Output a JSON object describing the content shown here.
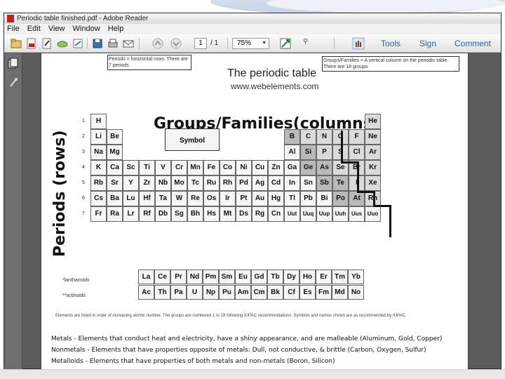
{
  "window": {
    "title": "Periodic table finished.pdf - Adobe Reader"
  },
  "menu": [
    "File",
    "Edit",
    "View",
    "Window",
    "Help"
  ],
  "toolbar": {
    "page_current": "1",
    "page_total": "/ 1",
    "zoom": "75%",
    "tools_label": "Tools",
    "sign_label": "Sign",
    "comment_label": "Comment"
  },
  "document": {
    "title": "The periodic table",
    "url": "www.webelements.com",
    "handwriting": {
      "groups": "Groups/Families(columns)",
      "periods": "Periods (rows)",
      "periods_note": "Periods = horizontal rows. There are 7 periods",
      "groups_note": "Groups/Families = A vertical column on the periodic table. There are 18 groups",
      "metals": "Metals - Elements that conduct heat and electricity, have a shiny appearance, and are malleable (Aluminum, Gold, Copper)",
      "metalloids": "Metalloids - Elements that have properties of both metals and non-metals (Boron, Silicon)",
      "nonmetals": "Nonmetals - Elements that have properties opposite of metals: Dull, not conductive, & brittle (Carbon, Oxygen, Sulfur)"
    },
    "key_symbol": "Symbol",
    "lanthanoids_label": "*lanthanoids",
    "actinoids_label": "**actinoids",
    "periods_numbers": [
      "1",
      "2",
      "3",
      "4",
      "5",
      "6",
      "7"
    ],
    "main_table": [
      [
        "H",
        "",
        "",
        "",
        "",
        "",
        "",
        "",
        "",
        "",
        "",
        "",
        "",
        "",
        "",
        "",
        "",
        "He"
      ],
      [
        "Li",
        "Be",
        "",
        "",
        "",
        "",
        "",
        "",
        "",
        "",
        "",
        "",
        "B",
        "C",
        "N",
        "O",
        "F",
        "Ne"
      ],
      [
        "Na",
        "Mg",
        "",
        "",
        "",
        "",
        "",
        "",
        "",
        "",
        "",
        "",
        "Al",
        "Si",
        "P",
        "S",
        "Cl",
        "Ar"
      ],
      [
        "K",
        "Ca",
        "Sc",
        "Ti",
        "V",
        "Cr",
        "Mn",
        "Fe",
        "Co",
        "Ni",
        "Cu",
        "Zn",
        "Ga",
        "Ge",
        "As",
        "Se",
        "Br",
        "Kr"
      ],
      [
        "Rb",
        "Sr",
        "Y",
        "Zr",
        "Nb",
        "Mo",
        "Tc",
        "Ru",
        "Rh",
        "Pd",
        "Ag",
        "Cd",
        "In",
        "Sn",
        "Sb",
        "Te",
        "I",
        "Xe"
      ],
      [
        "Cs",
        "Ba",
        "Lu",
        "Hf",
        "Ta",
        "W",
        "Re",
        "Os",
        "Ir",
        "Pt",
        "Au",
        "Hg",
        "Tl",
        "Pb",
        "Bi",
        "Po",
        "At",
        "Rn"
      ],
      [
        "Fr",
        "Ra",
        "Lr",
        "Rf",
        "Db",
        "Sg",
        "Bh",
        "Hs",
        "Mt",
        "Ds",
        "Rg",
        "Cn",
        "Uut",
        "Uuq",
        "Uup",
        "Uuh",
        "Uus",
        "Uuo"
      ]
    ],
    "lanthanoids": [
      "La",
      "Ce",
      "Pr",
      "Nd",
      "Pm",
      "Sm",
      "Eu",
      "Gd",
      "Tb",
      "Dy",
      "Ho",
      "Er",
      "Tm",
      "Yb"
    ],
    "actinoids": [
      "Ac",
      "Th",
      "Pa",
      "U",
      "Np",
      "Pu",
      "Am",
      "Cm",
      "Bk",
      "Cf",
      "Es",
      "Fm",
      "Md",
      "No"
    ],
    "footer": "Elements are listed in order of increasing atomic number. The groups are numbered 1 to 18 following IUPAC recommendations. Symbols and names shown are as recommended by IUPAC."
  },
  "colors": {
    "link": "#25609e",
    "pdf_red": "#c81e1e",
    "metalloid_shade": "#b9b9b9"
  }
}
